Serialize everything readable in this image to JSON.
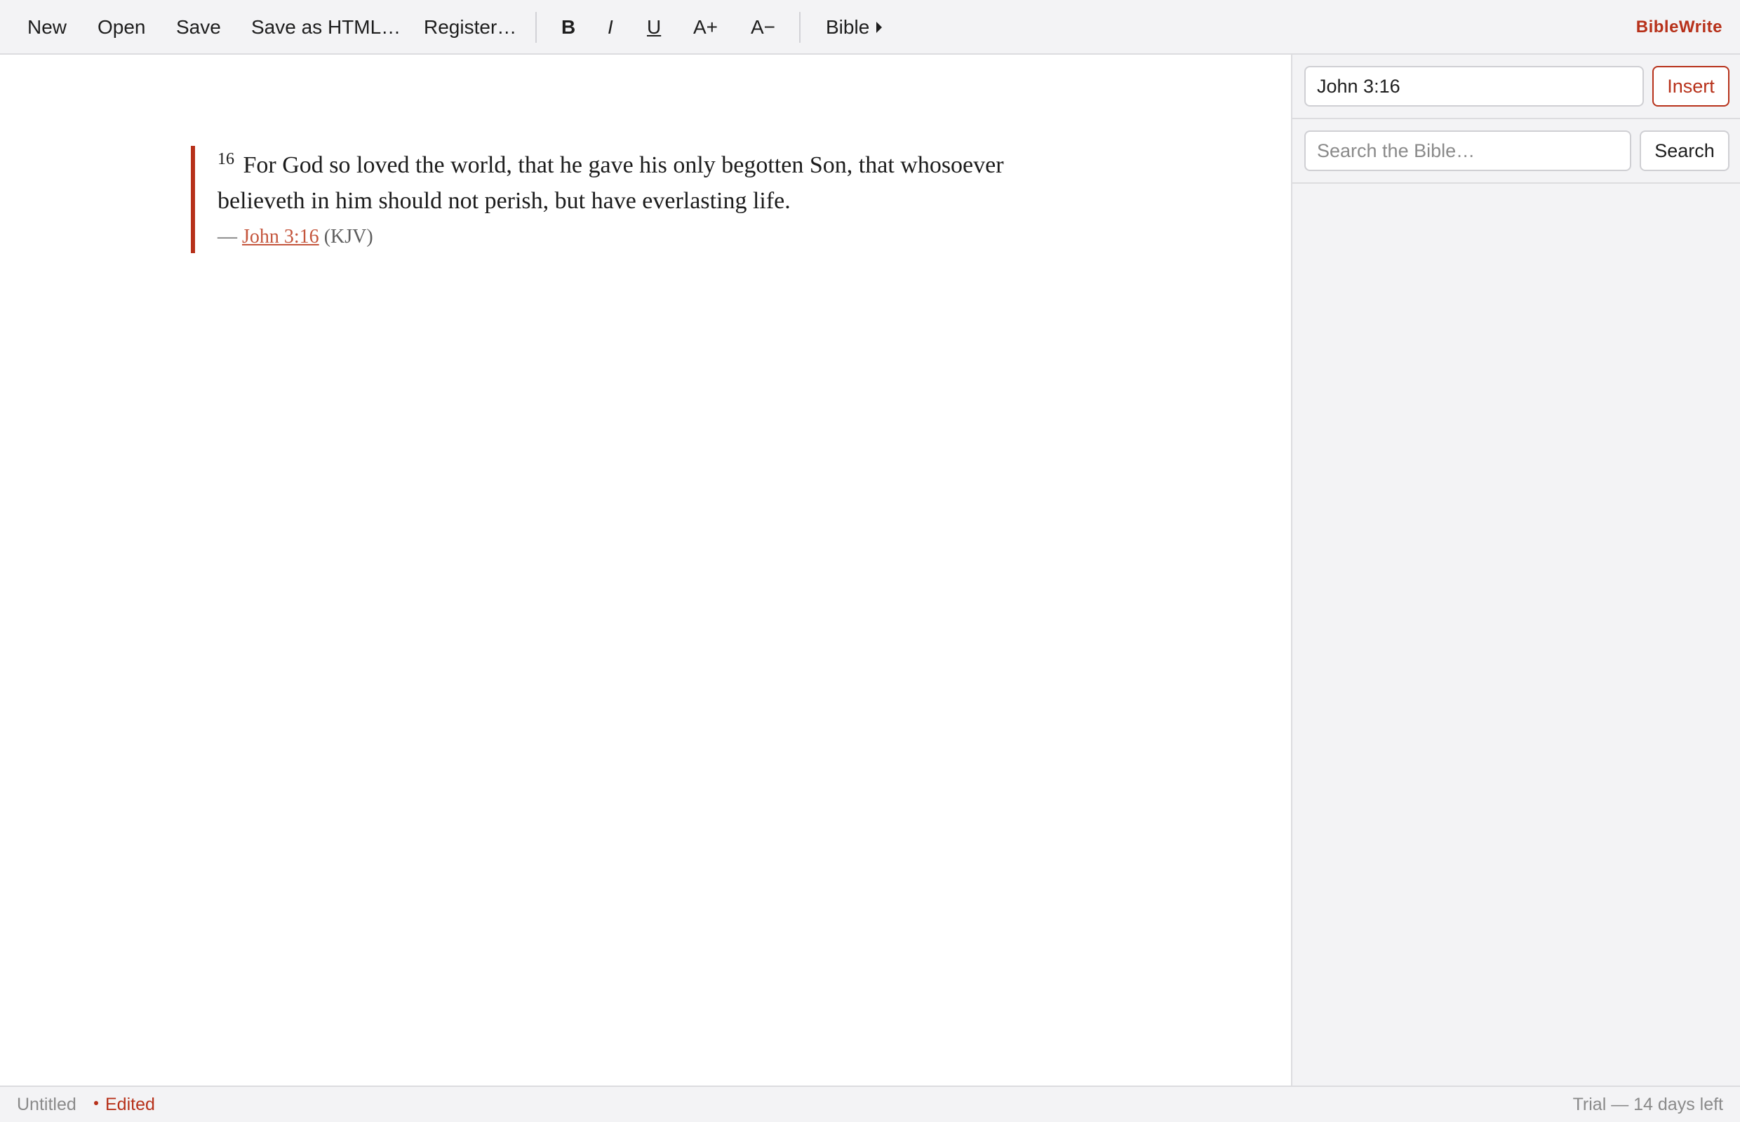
{
  "app": {
    "brand": "BibleWrite"
  },
  "toolbar": {
    "new_label": "New",
    "open_label": "Open",
    "save_label": "Save",
    "save_html_label": "Save as HTML…",
    "register_label": "Register…",
    "bold_label": "B",
    "italic_label": "I",
    "underline_label": "U",
    "font_up_label": "A+",
    "font_down_label": "A−",
    "bible_menu_label": "Bible"
  },
  "editor": {
    "verse_number": "16",
    "verse_text": "For God so loved the world, that he gave his only begotten Son, that whosoever believeth in him should not perish, but have everlasting life.",
    "citation_dash": "—",
    "citation_ref": "John 3:16",
    "citation_version": "(KJV)"
  },
  "sidebar": {
    "reference_value": "John 3:16",
    "insert_label": "Insert",
    "search_placeholder": "Search the Bible…",
    "search_value": "",
    "search_label": "Search"
  },
  "status": {
    "doc_name": "Untitled",
    "edited_label": "Edited",
    "trial_label": "Trial — 14 days left"
  },
  "colors": {
    "accent": "#b7311a",
    "link": "#c4553c",
    "chrome_bg": "#f3f3f5",
    "border": "#dcdcdf",
    "muted_text": "#8a8a8a"
  },
  "icons": {
    "bible_menu": "caret-right-icon",
    "edited": "dot-icon"
  }
}
